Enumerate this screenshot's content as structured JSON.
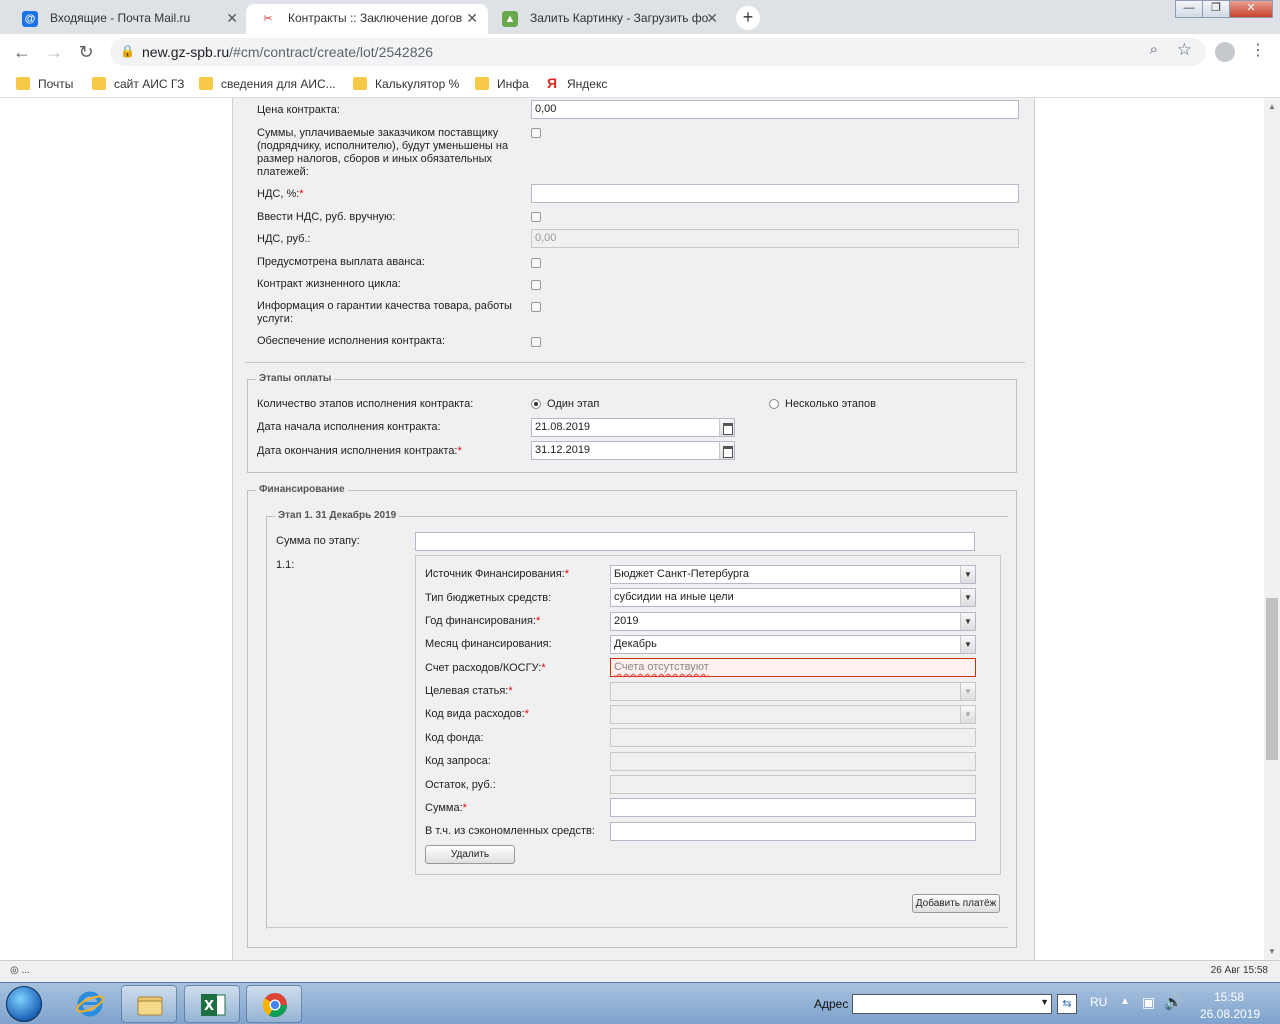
{
  "browser": {
    "tabs": [
      {
        "title": "Входящие - Почта Mail.ru",
        "close": "✕"
      },
      {
        "title": "Контракты :: Заключение догов",
        "close": "✕"
      },
      {
        "title": "Залить Картинку - Загрузить фо",
        "close": "✕"
      }
    ],
    "url_host": "new.gz-spb.ru",
    "url_path": "/#cm/contract/create/lot/2542826",
    "bookmarks": [
      "Почты",
      "сайт АИС ГЗ",
      "сведения для АИС...",
      "Калькулятор %",
      "Инфа",
      "Яндекс"
    ],
    "window_buttons": {
      "minimize": "—",
      "restore": "❐",
      "close": "✕"
    }
  },
  "contract": {
    "price_label": "Цена контракта:",
    "price_value": "0,00",
    "taxes_reduced_label": "Суммы, уплачиваемые заказчиком поставщику (подрядчику, исполнителю), будут уменьшены на размер налогов, сборов и иных обязательных платежей:",
    "vat_pct_label": "НДС, %:",
    "vat_manual_label": "Ввести НДС, руб. вручную:",
    "vat_rub_label": "НДС, руб.:",
    "vat_rub_value": "0,00",
    "advance_label": "Предусмотрена выплата аванса:",
    "lifecycle_label": "Контракт жизненного цикла:",
    "guarantee_label": "Информация о гарантии качества товара, работы услуги:",
    "security_label": "Обеспечение исполнения контракта:"
  },
  "payment_stages": {
    "legend": "Этапы оплаты",
    "count_label": "Количество этапов исполнения контракта:",
    "option_one": "Один этап",
    "option_many": "Несколько этапов",
    "start_label": "Дата начала исполнения контракта:",
    "start_value": "21.08.2019",
    "end_label": "Дата окончания исполнения контракта:",
    "end_value": "31.12.2019"
  },
  "financing": {
    "legend": "Финансирование",
    "stage_legend": "Этап 1. 31 Декабрь 2019",
    "stage_sum_label": "Сумма по этапу:",
    "item_number": "1.1:",
    "source_label": "Источник Финансирования:",
    "source_value": "Бюджет Санкт-Петербурга",
    "budget_type_label": "Тип бюджетных средств:",
    "budget_type_value": "субсидии на иные цели",
    "year_label": "Год финансирования:",
    "year_value": "2019",
    "month_label": "Месяц финансирования:",
    "month_value": "Декабрь",
    "account_label": "Счет расходов/КОСГУ:",
    "account_placeholder": "Счета отсутствуют",
    "target_label": "Целевая статья:",
    "expense_type_label": "Код вида расходов:",
    "fund_label": "Код фонда:",
    "request_label": "Код запроса:",
    "balance_label": "Остаток, руб.:",
    "sum_label": "Сумма:",
    "saved_label": "В т.ч. из сэкономленных средств:",
    "delete_button": "Удалить",
    "add_payment_button": "Добавить платёж"
  },
  "statusbar": {
    "left": "◎ ...",
    "right": "26 Авг 15:58"
  },
  "taskbar": {
    "address_label": "Адрес",
    "lang": "RU",
    "time": "15:58",
    "date": "26.08.2019"
  },
  "colors": {
    "required": "#ee0000",
    "page_bg": "#f0f0f0",
    "error_border": "#cc3300"
  }
}
